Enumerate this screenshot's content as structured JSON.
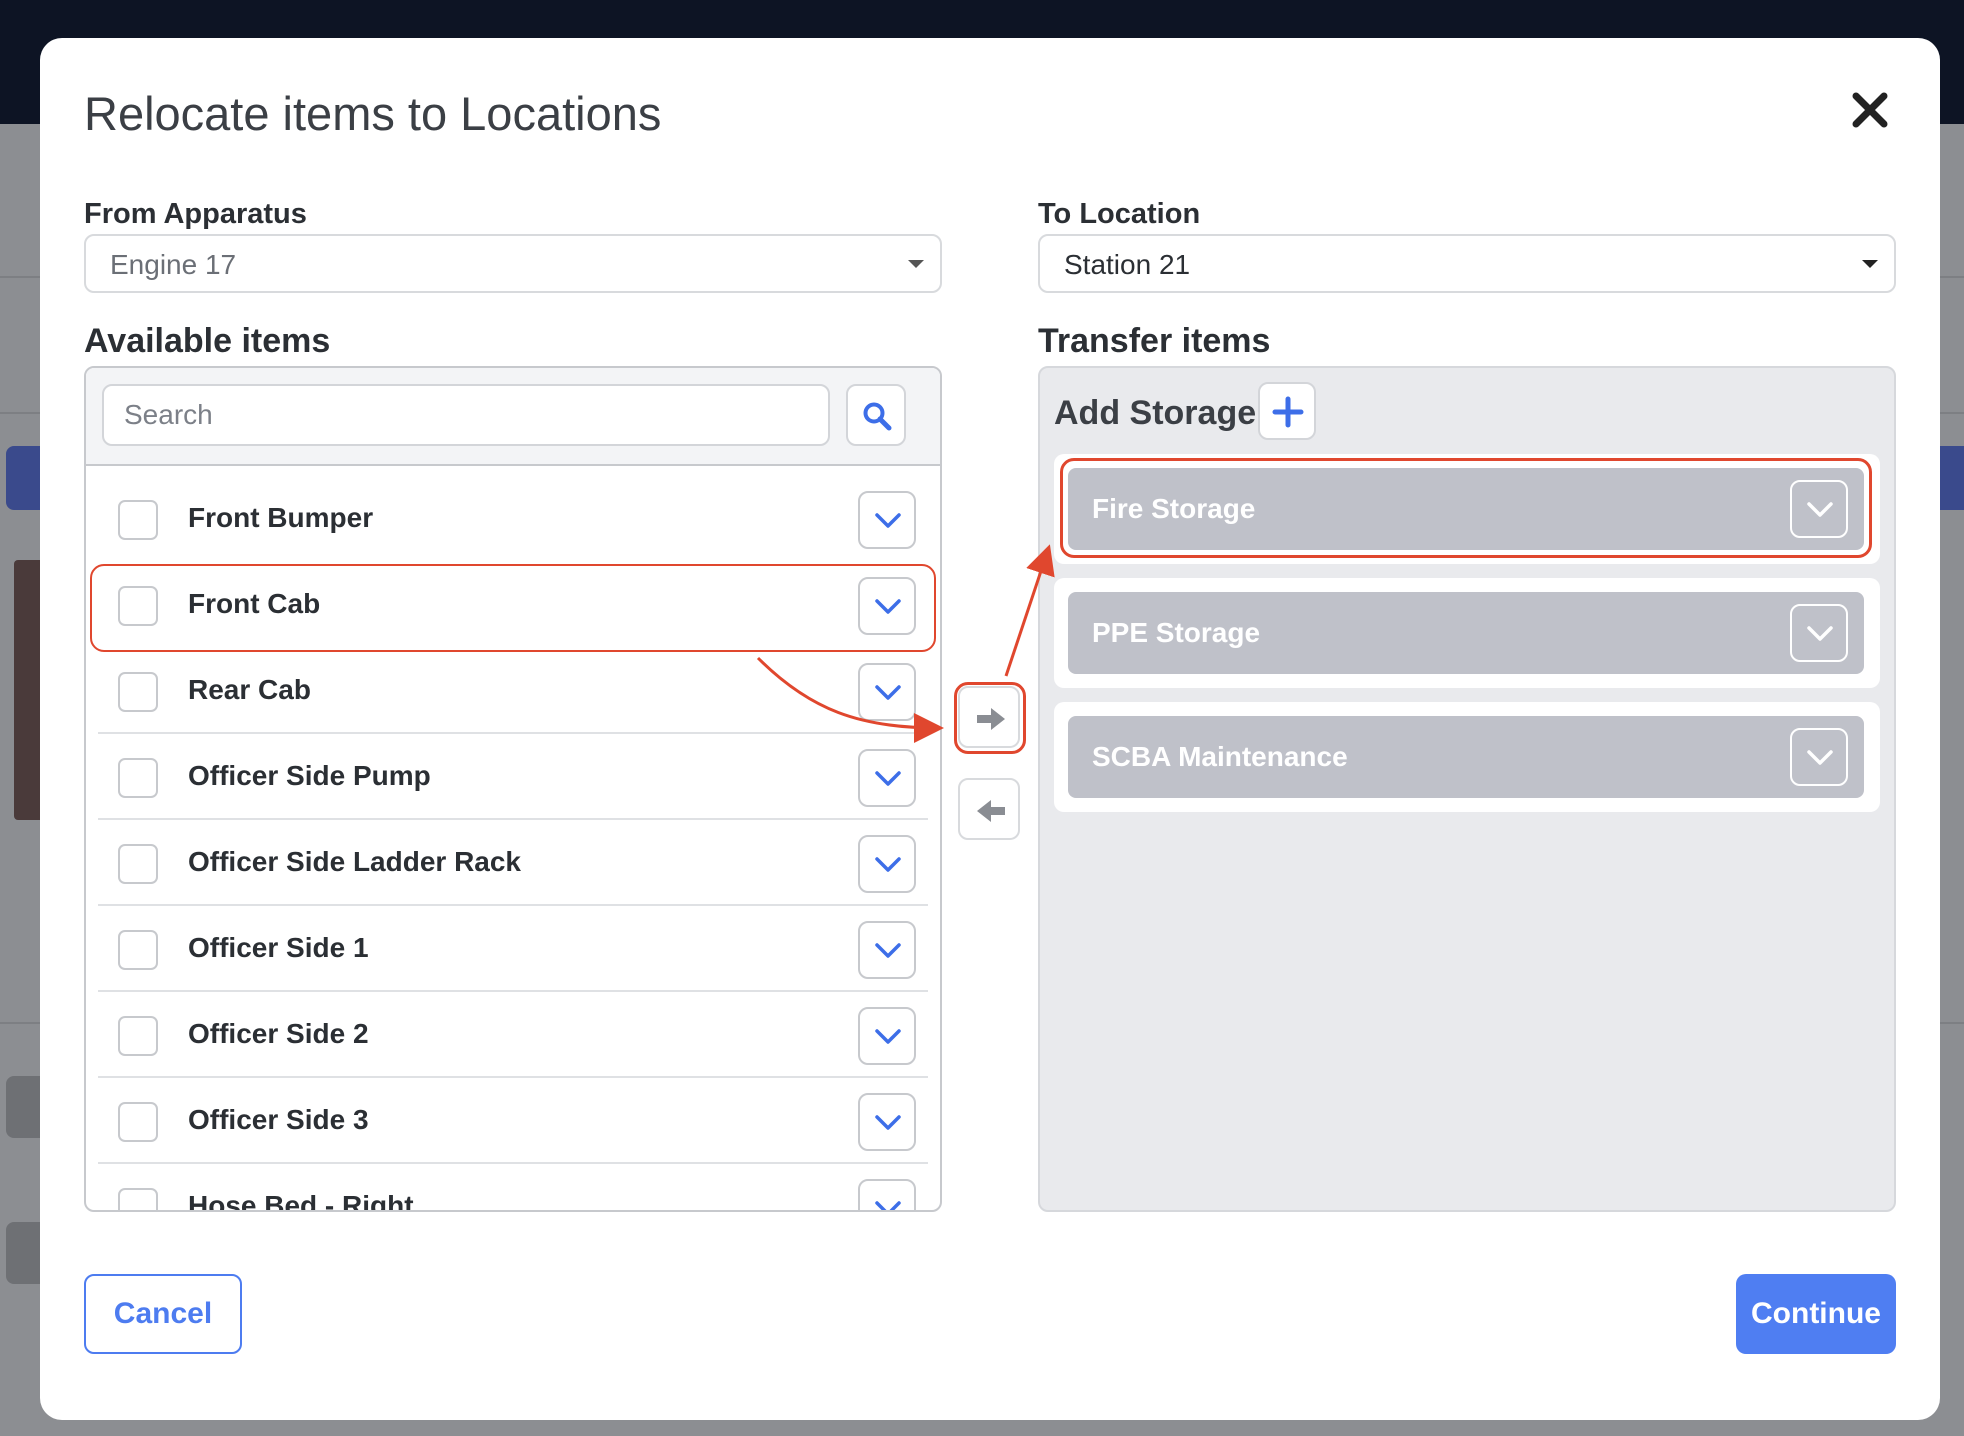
{
  "modal": {
    "title": "Relocate items to Locations"
  },
  "from": {
    "label": "From Apparatus",
    "value": "Engine 17"
  },
  "to": {
    "label": "To Location",
    "value": "Station 21"
  },
  "available": {
    "title": "Available items",
    "search_placeholder": "Search",
    "items": [
      {
        "label": "Front Bumper",
        "checked": false
      },
      {
        "label": "Front Cab",
        "checked": false
      },
      {
        "label": "Rear Cab",
        "checked": false
      },
      {
        "label": "Officer Side Pump",
        "checked": false
      },
      {
        "label": "Officer Side Ladder Rack",
        "checked": false
      },
      {
        "label": "Officer Side 1",
        "checked": false
      },
      {
        "label": "Officer Side 2",
        "checked": false
      },
      {
        "label": "Officer Side 3",
        "checked": false
      },
      {
        "label": "Hose Bed - Right",
        "checked": false
      }
    ]
  },
  "transfer": {
    "title": "Transfer items",
    "add_storage_label": "Add Storage",
    "storages": [
      {
        "name": "Fire Storage"
      },
      {
        "name": "PPE Storage"
      },
      {
        "name": "SCBA Maintenance"
      }
    ]
  },
  "footer": {
    "cancel_label": "Cancel",
    "continue_label": "Continue"
  },
  "colors": {
    "accent": "#4f7ef2",
    "annotation": "#e0472e",
    "storage_bg": "#bfc1c9"
  },
  "icons": {
    "close": "close-icon",
    "search": "search-icon",
    "expand": "chevron-down-icon",
    "move_right": "arrow-right-icon",
    "move_left": "arrow-left-icon",
    "add": "plus-icon"
  }
}
